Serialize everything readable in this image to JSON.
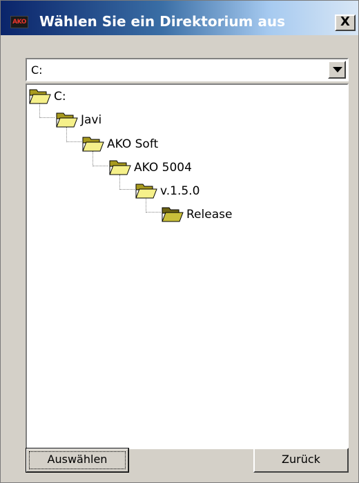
{
  "window": {
    "title": "Wählen Sie ein Direktorium aus",
    "app_icon_text": "AKO",
    "close_glyph": "X"
  },
  "drive_combo": {
    "value": "C:"
  },
  "tree": {
    "nodes": [
      {
        "label": "C:",
        "icon": "open-folder-icon"
      },
      {
        "label": "Javi",
        "icon": "open-folder-icon"
      },
      {
        "label": "AKO Soft",
        "icon": "open-folder-icon"
      },
      {
        "label": "AKO 5004",
        "icon": "open-folder-icon"
      },
      {
        "label": "v.1.5.0",
        "icon": "open-folder-icon"
      },
      {
        "label": "Release",
        "icon": "open-folder-icon",
        "selected_style": "darker"
      }
    ]
  },
  "buttons": {
    "select_label": "Auswählen",
    "back_label": "Zurück"
  },
  "colors": {
    "folder_fill": "#f5f08a",
    "folder_dark": "#a89a1e",
    "title_start": "#0a246a",
    "title_end": "#d8e6f5"
  }
}
